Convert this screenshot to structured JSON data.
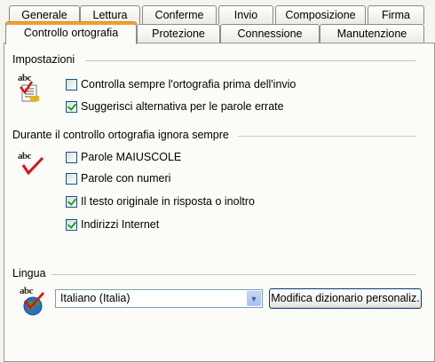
{
  "tabs_back": [
    "Generale",
    "Lettura",
    "Conferme",
    "Invio",
    "Composizione",
    "Firma"
  ],
  "tabs_front": [
    "Controllo ortografia",
    "Protezione",
    "Connessione",
    "Manutenzione"
  ],
  "active_tab": "Controllo ortografia",
  "impostazioni": {
    "title": "Impostazioni",
    "options": [
      {
        "label": "Controlla sempre l'ortografia prima dell'invio",
        "checked": false
      },
      {
        "label": "Suggerisci alternativa per le parole errate",
        "checked": true
      }
    ]
  },
  "ignora": {
    "title": "Durante il controllo ortografia ignora sempre",
    "options": [
      {
        "label": "Parole MAIUSCOLE",
        "checked": false
      },
      {
        "label": "Parole con numeri",
        "checked": false
      },
      {
        "label": "Il testo originale in risposta o inoltro",
        "checked": true
      },
      {
        "label": "Indirizzi Internet",
        "checked": true
      }
    ]
  },
  "lingua": {
    "title": "Lingua",
    "selected": "Italiano (Italia)",
    "button_label": "Modifica dizionario personaliz."
  },
  "icons": {
    "abc_text": "abc",
    "settings_icon": "abc-document-icon",
    "ignore_icon": "abc-checkmark-icon",
    "language_icon": "abc-globe-icon"
  }
}
